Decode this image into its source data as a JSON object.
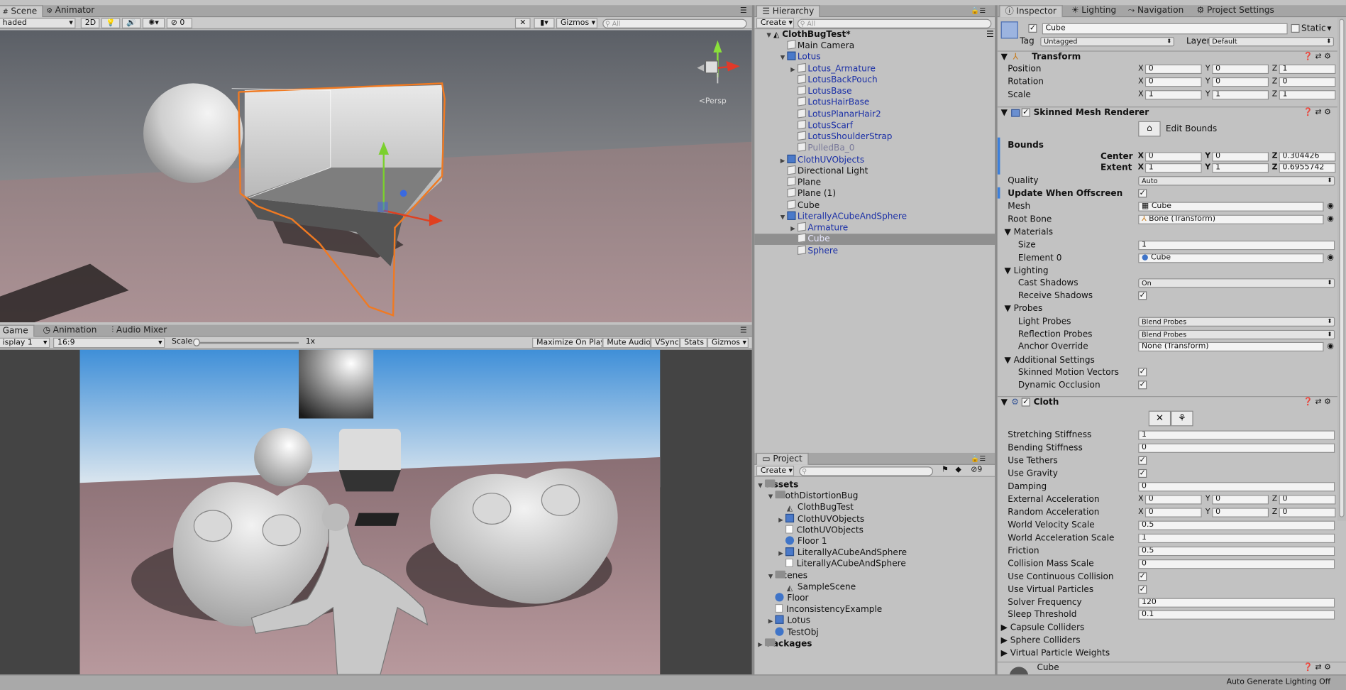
{
  "scene_window": {
    "tabs": [
      "Scene",
      "Animator"
    ],
    "shading": "haded",
    "mode_2d": "2D",
    "hidden_count": "0",
    "gizmos": "Gizmos",
    "search_placeholder": "All",
    "persp": "<Persp"
  },
  "game_window": {
    "tabs": [
      "Game",
      "Animation",
      "Audio Mixer"
    ],
    "display": "isplay 1",
    "aspect": "16:9",
    "scale_label": "Scale",
    "scale_value": "1x",
    "buttons": [
      "Maximize On Play",
      "Mute Audio",
      "VSync",
      "Stats",
      "Gizmos"
    ]
  },
  "hierarchy": {
    "tab": "Hierarchy",
    "create": "Create",
    "search_placeholder": "All",
    "scene_name": "ClothBugTest*",
    "items": [
      {
        "label": "Main Camera",
        "indent": 1,
        "color": "black",
        "arrow": "",
        "icon": "go"
      },
      {
        "label": "Lotus",
        "indent": 1,
        "color": "blue",
        "arrow": "▼",
        "icon": "pf"
      },
      {
        "label": "Lotus_Armature",
        "indent": 2,
        "color": "blue",
        "arrow": "▶",
        "icon": "go"
      },
      {
        "label": "LotusBackPouch",
        "indent": 2,
        "color": "blue",
        "arrow": "",
        "icon": "go"
      },
      {
        "label": "LotusBase",
        "indent": 2,
        "color": "blue",
        "arrow": "",
        "icon": "go"
      },
      {
        "label": "LotusHairBase",
        "indent": 2,
        "color": "blue",
        "arrow": "",
        "icon": "go"
      },
      {
        "label": "LotusPlanarHair2",
        "indent": 2,
        "color": "blue",
        "arrow": "",
        "icon": "go"
      },
      {
        "label": "LotusScarf",
        "indent": 2,
        "color": "blue",
        "arrow": "",
        "icon": "go"
      },
      {
        "label": "LotusShoulderStrap",
        "indent": 2,
        "color": "blue",
        "arrow": "",
        "icon": "go"
      },
      {
        "label": "PulledBa_0",
        "indent": 2,
        "color": "gray",
        "arrow": "",
        "icon": "go"
      },
      {
        "label": "ClothUVObjects",
        "indent": 1,
        "color": "blue",
        "arrow": "▶",
        "icon": "pf"
      },
      {
        "label": "Directional Light",
        "indent": 1,
        "color": "black",
        "arrow": "",
        "icon": "go"
      },
      {
        "label": "Plane",
        "indent": 1,
        "color": "black",
        "arrow": "",
        "icon": "go"
      },
      {
        "label": "Plane (1)",
        "indent": 1,
        "color": "black",
        "arrow": "",
        "icon": "go"
      },
      {
        "label": "Cube",
        "indent": 1,
        "color": "black",
        "arrow": "",
        "icon": "go"
      },
      {
        "label": "LiterallyACubeAndSphere",
        "indent": 1,
        "color": "blue",
        "arrow": "▼",
        "icon": "pf"
      },
      {
        "label": "Armature",
        "indent": 2,
        "color": "blue",
        "arrow": "▶",
        "icon": "go"
      },
      {
        "label": "Cube",
        "indent": 2,
        "color": "selected",
        "arrow": "",
        "icon": "go"
      },
      {
        "label": "Sphere",
        "indent": 2,
        "color": "blue",
        "arrow": "",
        "icon": "go"
      }
    ]
  },
  "project": {
    "tab": "Project",
    "create": "Create",
    "hidden_count": "9",
    "items": [
      {
        "label": "Assets",
        "indent": 0,
        "arrow": "▼",
        "icon": "fld",
        "bold": true
      },
      {
        "label": "ClothDistortionBug",
        "indent": 1,
        "arrow": "▼",
        "icon": "fld",
        "bold": false
      },
      {
        "label": "ClothBugTest",
        "indent": 2,
        "arrow": "",
        "icon": "uni",
        "bold": false
      },
      {
        "label": "ClothUVObjects",
        "indent": 2,
        "arrow": "▶",
        "icon": "pf",
        "bold": false
      },
      {
        "label": "ClothUVObjects",
        "indent": 2,
        "arrow": "",
        "icon": "doc",
        "bold": false
      },
      {
        "label": "Floor 1",
        "indent": 2,
        "arrow": "",
        "icon": "sph",
        "bold": false
      },
      {
        "label": "LiterallyACubeAndSphere",
        "indent": 2,
        "arrow": "▶",
        "icon": "pf",
        "bold": false
      },
      {
        "label": "LiterallyACubeAndSphere",
        "indent": 2,
        "arrow": "",
        "icon": "doc",
        "bold": false
      },
      {
        "label": "Scenes",
        "indent": 1,
        "arrow": "▼",
        "icon": "fld",
        "bold": false
      },
      {
        "label": "SampleScene",
        "indent": 2,
        "arrow": "",
        "icon": "uni",
        "bold": false
      },
      {
        "label": "Floor",
        "indent": 1,
        "arrow": "",
        "icon": "sph",
        "bold": false
      },
      {
        "label": "InconsistencyExample",
        "indent": 1,
        "arrow": "",
        "icon": "doc",
        "bold": false
      },
      {
        "label": "Lotus",
        "indent": 1,
        "arrow": "▶",
        "icon": "pf",
        "bold": false
      },
      {
        "label": "TestObj",
        "indent": 1,
        "arrow": "",
        "icon": "sph",
        "bold": false
      },
      {
        "label": "Packages",
        "indent": 0,
        "arrow": "▶",
        "icon": "fld",
        "bold": true
      }
    ]
  },
  "inspector": {
    "tabs": [
      "Inspector",
      "Lighting",
      "Navigation",
      "Project Settings"
    ],
    "object_name": "Cube",
    "static_label": "Static",
    "tag_label": "Tag",
    "tag_value": "Untagged",
    "layer_label": "Layer",
    "layer_value": "Default",
    "transform": {
      "title": "Transform",
      "position_label": "Position",
      "position": [
        "0",
        "0",
        "1"
      ],
      "rotation_label": "Rotation",
      "rotation": [
        "0",
        "0",
        "0"
      ],
      "scale_label": "Scale",
      "scale": [
        "1",
        "1",
        "1"
      ]
    },
    "smr": {
      "title": "Skinned Mesh Renderer",
      "edit_bounds": "Edit Bounds",
      "bounds_label": "Bounds",
      "center_label": "Center",
      "center": [
        "0",
        "0",
        "0.304426"
      ],
      "extent_label": "Extent",
      "extent": [
        "1",
        "1",
        "0.6955742"
      ],
      "quality_label": "Quality",
      "quality": "Auto",
      "update_offscreen_label": "Update When Offscreen",
      "mesh_label": "Mesh",
      "mesh": "Cube",
      "root_bone_label": "Root Bone",
      "root_bone": "Bone (Transform)",
      "materials_label": "Materials",
      "size_label": "Size",
      "size": "1",
      "element0_label": "Element 0",
      "element0": "Cube",
      "lighting_label": "Lighting",
      "cast_shadows_label": "Cast Shadows",
      "cast_shadows": "On",
      "receive_shadows_label": "Receive Shadows",
      "probes_label": "Probes",
      "light_probes_label": "Light Probes",
      "light_probes": "Blend Probes",
      "reflection_probes_label": "Reflection Probes",
      "reflection_probes": "Blend Probes",
      "anchor_override_label": "Anchor Override",
      "anchor_override": "None (Transform)",
      "additional_label": "Additional Settings",
      "skinned_motion_label": "Skinned Motion Vectors",
      "dynamic_occlusion_label": "Dynamic Occlusion"
    },
    "cloth": {
      "title": "Cloth",
      "stretching_label": "Stretching Stiffness",
      "stretching": "1",
      "bending_label": "Bending Stiffness",
      "bending": "0",
      "use_tethers_label": "Use Tethers",
      "use_gravity_label": "Use Gravity",
      "damping_label": "Damping",
      "damping": "0",
      "ext_accel_label": "External Acceleration",
      "ext_accel": [
        "0",
        "0",
        "0"
      ],
      "rand_accel_label": "Random Acceleration",
      "rand_accel": [
        "0",
        "0",
        "0"
      ],
      "world_vel_label": "World Velocity Scale",
      "world_vel": "0.5",
      "world_accel_label": "World Acceleration Scale",
      "world_accel": "1",
      "friction_label": "Friction",
      "friction": "0.5",
      "collision_mass_label": "Collision Mass Scale",
      "collision_mass": "0",
      "continuous_label": "Use Continuous Collision",
      "virtual_particles_label": "Use Virtual Particles",
      "solver_label": "Solver Frequency",
      "solver": "120",
      "sleep_label": "Sleep Threshold",
      "sleep": "0.1",
      "capsule_label": "Capsule Colliders",
      "sphere_label": "Sphere Colliders",
      "vpw_label": "Virtual Particle Weights"
    },
    "material_name": "Cube"
  },
  "status_bar": {
    "text": "Auto Generate Lighting Off"
  },
  "colors": {
    "selection_orange": "#f07a22",
    "prefab_blue": "#1a2fa6",
    "panel_bg": "#c2c2c2"
  }
}
